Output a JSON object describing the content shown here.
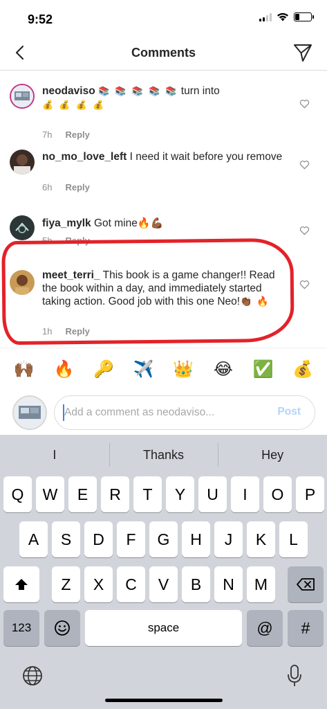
{
  "status_bar": {
    "time": "9:52"
  },
  "nav": {
    "title": "Comments"
  },
  "comments": [
    {
      "username": "neodaviso",
      "text_before": "",
      "emoji_inline": "📚 📚 📚 📚 📚",
      "text_after": "turn into",
      "emoji_trailing": "💰 💰 💰 💰",
      "time": "7h",
      "reply_label": "Reply"
    },
    {
      "username": "no_mo_love_left",
      "text": "I need it wait before you remove",
      "time": "6h",
      "reply_label": "Reply"
    },
    {
      "username": "fiya_mylk",
      "text": "Got mine",
      "emoji_trailing": "🔥💪🏾",
      "time": "5h",
      "reply_label": "Reply"
    },
    {
      "username": "meet_terri_",
      "text": "This book is a game changer!! Read the book within a day, and immediately started taking action. Good job with this one Neo!",
      "emoji_trailing": "👏🏾 🔥",
      "time": "1h",
      "reply_label": "Reply"
    }
  ],
  "emoji_bar": [
    "🙌🏾",
    "🔥",
    "🔑",
    "✈️",
    "👑",
    "😂",
    "✅",
    "💰"
  ],
  "composer": {
    "placeholder": "Add a comment as neodaviso...",
    "post_label": "Post"
  },
  "keyboard": {
    "suggestions": [
      "I",
      "Thanks",
      "Hey"
    ],
    "row1": [
      "Q",
      "W",
      "E",
      "R",
      "T",
      "Y",
      "U",
      "I",
      "O",
      "P"
    ],
    "row2": [
      "A",
      "S",
      "D",
      "F",
      "G",
      "H",
      "J",
      "K",
      "L"
    ],
    "row3": [
      "Z",
      "X",
      "C",
      "V",
      "B",
      "N",
      "M"
    ],
    "numbers_label": "123",
    "space_label": "space",
    "at_label": "@",
    "hash_label": "#"
  },
  "colors": {
    "accent_post": "#b3d4fb",
    "annotation": "#e32229",
    "cursor": "#3b82f6"
  }
}
